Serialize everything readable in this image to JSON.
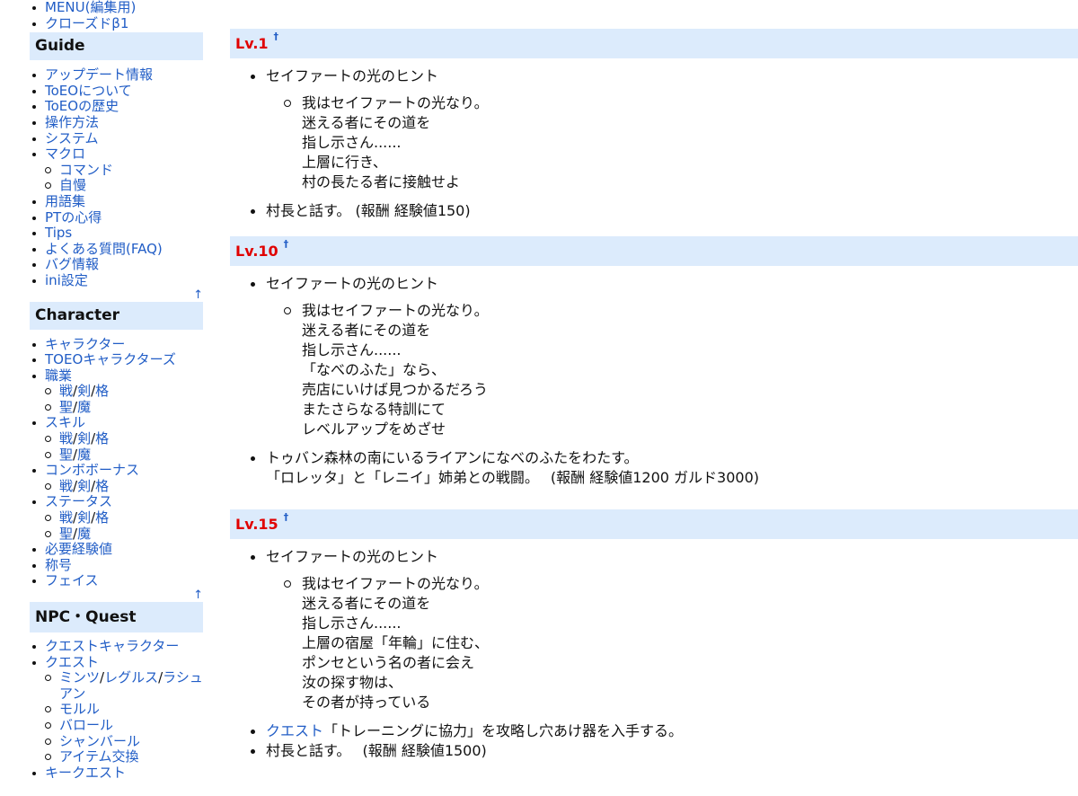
{
  "sidebar": {
    "top_items": [
      "MENU(編集用)",
      "クローズドβ1"
    ],
    "guide": {
      "title": "Guide",
      "items": [
        "アップデート情報",
        "ToEOについて",
        "ToEOの歴史",
        "操作方法",
        "システム",
        "マクロ"
      ],
      "macro_sub": [
        "コマンド",
        "自慢"
      ],
      "items_after": [
        "用語集",
        "PTの心得",
        "Tips",
        "よくある質問(FAQ)",
        "バグ情報",
        "ini設定"
      ]
    },
    "character": {
      "title": "Character",
      "items": [
        "キャラクター",
        "TOEOキャラクターズ"
      ],
      "job": "職業",
      "job_sub1": [
        "戦",
        "剣",
        "格"
      ],
      "job_sub2": [
        "聖",
        "魔"
      ],
      "skill": "スキル",
      "skill_sub1": [
        "戦",
        "剣",
        "格"
      ],
      "skill_sub2": [
        "聖",
        "魔"
      ],
      "combo": "コンボボーナス",
      "combo_sub1": [
        "戦",
        "剣",
        "格"
      ],
      "status": "ステータス",
      "status_sub1": [
        "戦",
        "剣",
        "格"
      ],
      "status_sub2": [
        "聖",
        "魔"
      ],
      "items_after": [
        "必要経験値",
        "称号",
        "フェイス"
      ]
    },
    "npc": {
      "title": "NPC・Quest",
      "items": [
        "クエストキャラクター",
        "クエスト"
      ],
      "quest_sub_towns": [
        "ミンツ",
        "レグルス",
        "ラシュアン"
      ],
      "quest_sub": [
        "モルル",
        "バロール",
        "シャンバール",
        "アイテム交換"
      ],
      "key_quest": "キークエスト"
    },
    "up_arrow": "↑",
    "slash": "/"
  },
  "content": {
    "anchor": "†",
    "sections": [
      {
        "title": "Lv.1",
        "hint_title": "セイファートの光のヒント",
        "hint_lines": [
          "我はセイファートの光なり。",
          "迷える者にその道を",
          "指し示さん......",
          "上層に行き、",
          "村の長たる者に接触せよ"
        ],
        "task": "村長と話す。 (報酬 経験値150)"
      },
      {
        "title": "Lv.10",
        "hint_title": "セイファートの光のヒント",
        "hint_lines": [
          "我はセイファートの光なり。",
          "迷える者にその道を",
          "指し示さん......",
          "「なべのふた」なら、",
          "売店にいけば見つかるだろう",
          "またさらなる特訓にて",
          "レベルアップをめざせ"
        ],
        "task_line1": "トゥバン森林の南にいるライアンになべのふたをわたす。",
        "task_line2": "「ロレッタ」と「レニイ」姉弟との戦闘。　 (報酬 経験値1200 ガルド3000)"
      },
      {
        "title": "Lv.15",
        "hint_title": "セイファートの光のヒント",
        "hint_lines": [
          "我はセイファートの光なり。",
          "迷える者にその道を",
          "指し示さん......",
          "上層の宿屋「年輪」に住む、",
          "ポンセという名の者に会え",
          "汝の探す物は、",
          "その者が持っている"
        ],
        "task1_link": "クエスト",
        "task1_rest": "「トレーニングに協力」を攻略し穴あけ器を入手する。",
        "task2": "村長と話す。　 (報酬 経験値1500)"
      }
    ]
  },
  "colors": {
    "heading_bg": "#dcebfc",
    "link": "#215dc6",
    "level_red": "#e00000"
  }
}
